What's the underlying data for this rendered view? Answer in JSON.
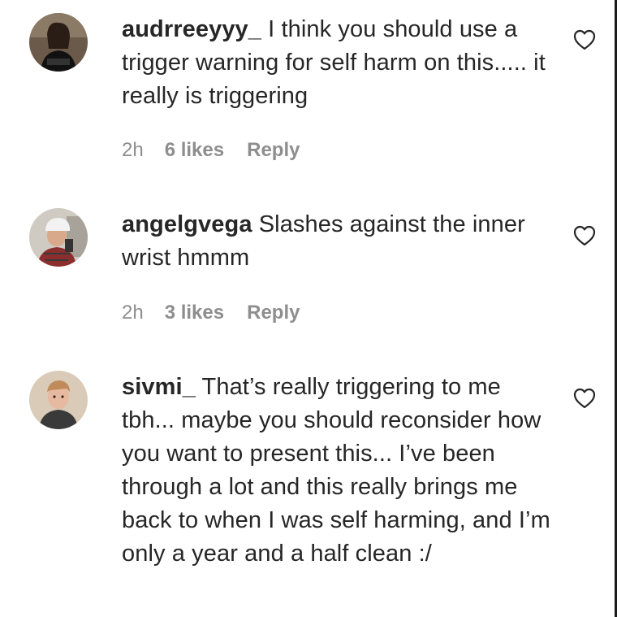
{
  "comments": [
    {
      "username": "audrreeyyy_",
      "text": " I think you should use a trigger warning for self harm on this..... it really is triggering",
      "time": "2h",
      "likes": "6 likes",
      "reply": "Reply",
      "avatar_icon": "user-avatar-icon"
    },
    {
      "username": "angelgvega",
      "text": " Slashes against the inner wrist hmmm",
      "time": "2h",
      "likes": "3 likes",
      "reply": "Reply",
      "avatar_icon": "user-avatar-icon"
    },
    {
      "username": "sivmi_",
      "text": " That’s really triggering to me tbh... maybe you should reconsider how you want to present this... I’ve been through a lot and this really brings me back to when I was self harming, and I’m only a year and a half clean :/",
      "avatar_icon": "user-avatar-icon"
    }
  ],
  "icons": {
    "like": "heart-outline-icon"
  },
  "colors": {
    "text": "#262626",
    "meta": "#8e8e8e"
  }
}
